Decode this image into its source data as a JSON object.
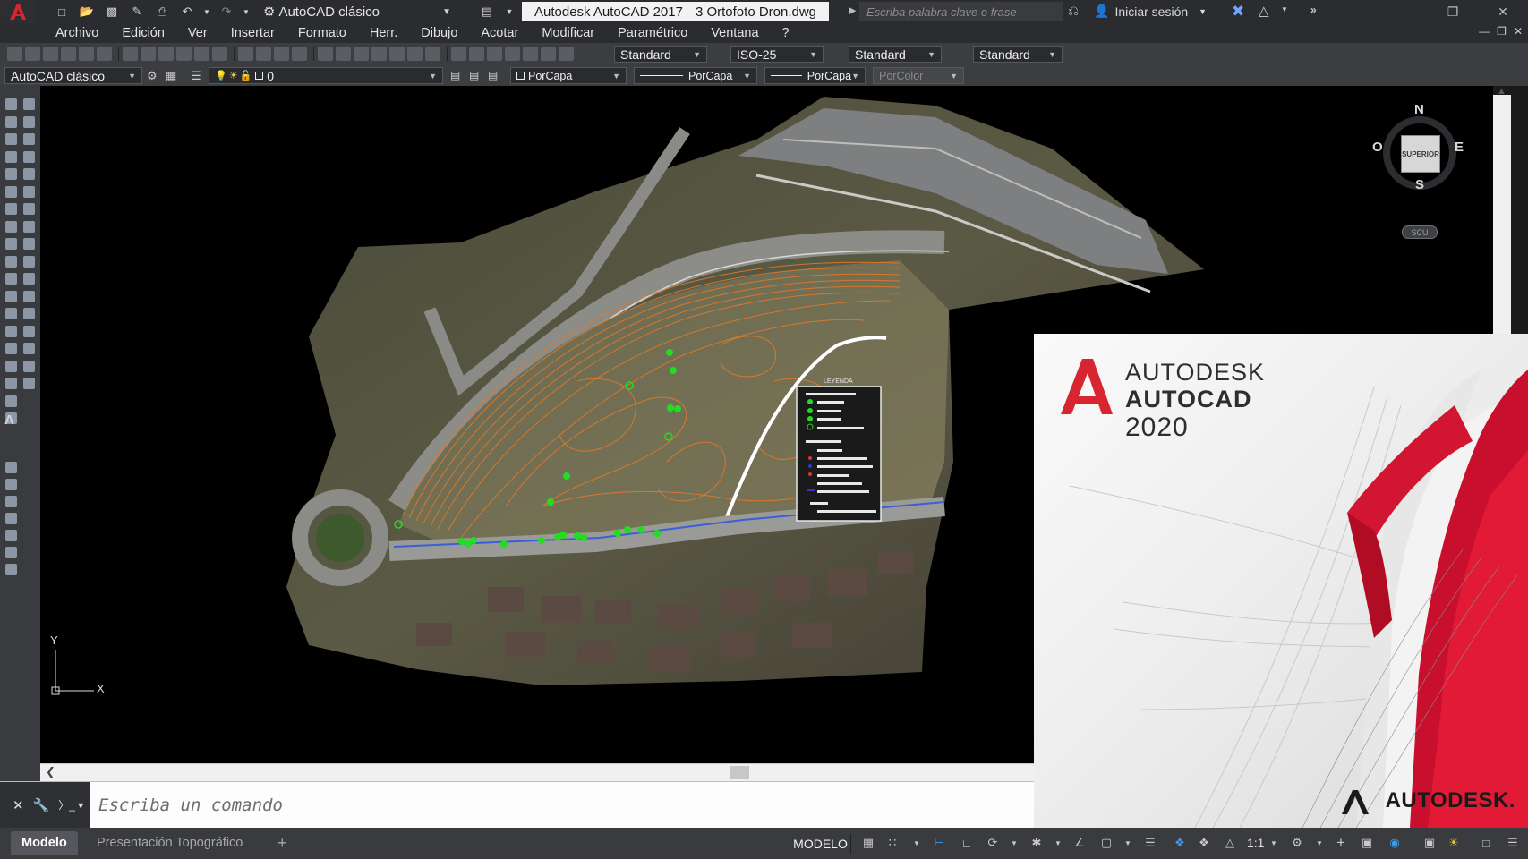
{
  "window": {
    "title_app": "Autodesk AutoCAD 2017",
    "title_file": "3 Ortofoto Dron.dwg",
    "search_placeholder": "Escriba palabra clave o frase",
    "signin_label": "Iniciar sesión",
    "workspace": "AutoCAD clásico"
  },
  "menu": {
    "items": [
      "Archivo",
      "Edición",
      "Ver",
      "Insertar",
      "Formato",
      "Herr.",
      "Dibujo",
      "Acotar",
      "Modificar",
      "Paramétrico",
      "Ventana",
      "?"
    ]
  },
  "toolbar1": {
    "text_style": "Standard",
    "dim_style": "ISO-25",
    "table_style": "Standard",
    "mleader_style": "Standard"
  },
  "toolbar2": {
    "workspace": "AutoCAD clásico",
    "layer": "0",
    "color": "PorCapa",
    "linetype": "PorCapa",
    "lineweight": "PorCapa",
    "plotstyle": "PorColor"
  },
  "viewcube": {
    "face": "SUPERIOR",
    "north": "N",
    "south": "S",
    "east": "E",
    "west": "O",
    "wcs": "SCU"
  },
  "ucs": {
    "x_label": "X",
    "y_label": "Y"
  },
  "legend": {
    "title": "LEYENDA"
  },
  "splash": {
    "brand": "AUTODESK",
    "product": "AUTOCAD",
    "year": "2020",
    "corner_brand": "AUTODESK."
  },
  "command": {
    "placeholder": "Escriba un comando"
  },
  "tabs": [
    "Modelo",
    "Presentación Topográfico"
  ],
  "status": {
    "model": "MODELO",
    "scale": "1:1"
  },
  "colors": {
    "accent": "#c8102e",
    "contour": "#e07a2a",
    "points": "#22dd22",
    "canvas": "#000000"
  }
}
